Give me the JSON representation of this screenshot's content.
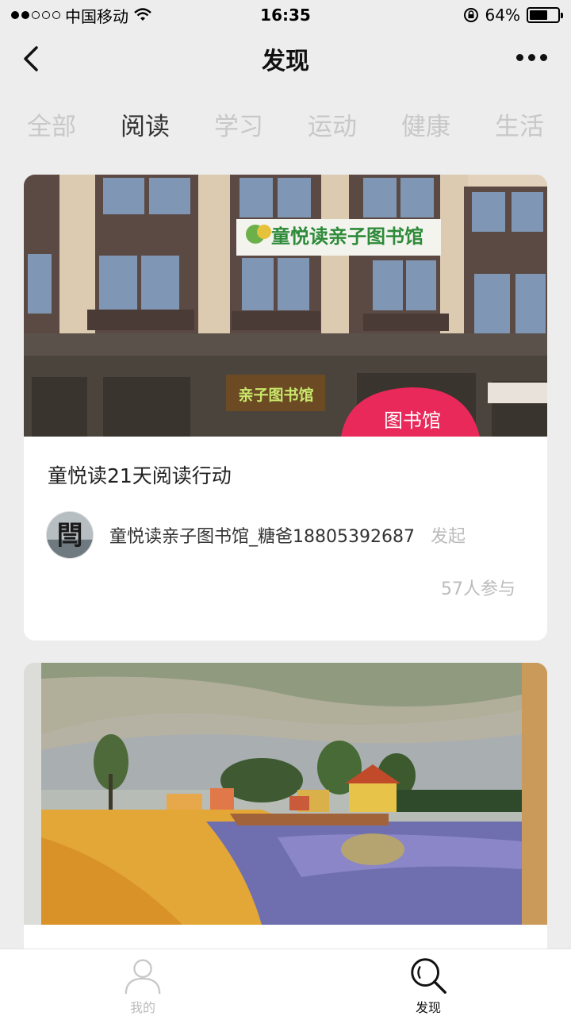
{
  "status_bar": {
    "carrier": "中国移动",
    "time": "16:35",
    "battery": "64%",
    "battery_level": 0.64,
    "signal_bars_filled": 2,
    "signal_bars_total": 5
  },
  "nav": {
    "title": "发现"
  },
  "tabs": [
    {
      "label": "全部",
      "active": false
    },
    {
      "label": "阅读",
      "active": true
    },
    {
      "label": "学习",
      "active": false
    },
    {
      "label": "运动",
      "active": false
    },
    {
      "label": "健康",
      "active": false
    },
    {
      "label": "生活",
      "active": false
    }
  ],
  "cards": [
    {
      "title": "童悦读21天阅读行动",
      "author": "童悦读亲子图书馆_糖爸18805392687",
      "author_tag": "发起",
      "participants": "57人参与",
      "image": {
        "sign_text": "童悦读亲子图书馆",
        "shop_sign_text": "亲子图书馆",
        "badge_text": "图书馆"
      },
      "avatar_glyph": "閆"
    },
    {
      "title": "",
      "image": {
        "subject": "oil-painting-village"
      }
    }
  ],
  "tabbar": {
    "mine_label": "我的",
    "discover_label": "发现"
  },
  "colors": {
    "background": "#ededed",
    "card": "#ffffff",
    "tab_inactive": "#c8c8c8",
    "tab_active": "#333333",
    "badge_red": "#e8295a",
    "sign_green": "#2e8b3a"
  }
}
